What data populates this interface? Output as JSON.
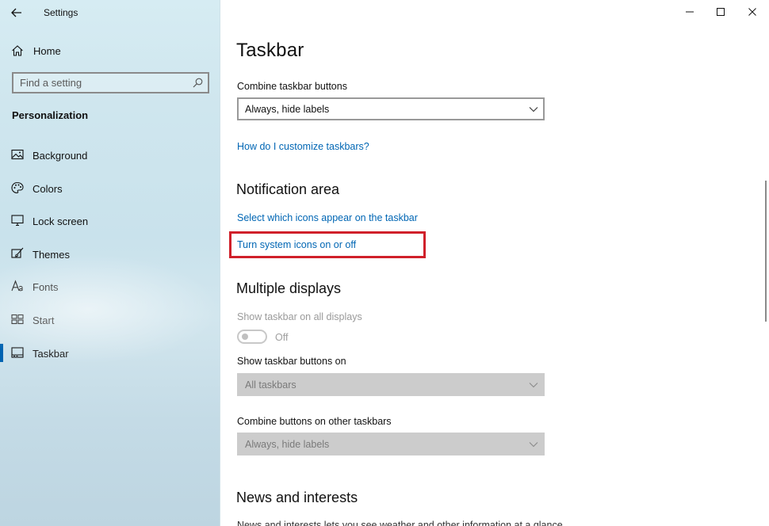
{
  "window": {
    "title": "Settings"
  },
  "sidebar": {
    "home_label": "Home",
    "search_placeholder": "Find a setting",
    "section_label": "Personalization",
    "items": [
      {
        "label": "Background",
        "icon": "image-icon"
      },
      {
        "label": "Colors",
        "icon": "palette-icon"
      },
      {
        "label": "Lock screen",
        "icon": "monitor-icon"
      },
      {
        "label": "Themes",
        "icon": "brush-icon"
      },
      {
        "label": "Fonts",
        "icon": "font-icon"
      },
      {
        "label": "Start",
        "icon": "start-grid-icon"
      },
      {
        "label": "Taskbar",
        "icon": "taskbar-icon",
        "selected": true
      }
    ]
  },
  "main": {
    "title": "Taskbar",
    "combine_label": "Combine taskbar buttons",
    "combine_value": "Always, hide labels",
    "customize_link": "How do I customize taskbars?",
    "notification_heading": "Notification area",
    "select_icons_link": "Select which icons appear on the taskbar",
    "system_icons_link": "Turn system icons on or off",
    "multiple_heading": "Multiple displays",
    "show_all_label": "Show taskbar on all displays",
    "show_all_state": "Off",
    "show_buttons_label": "Show taskbar buttons on",
    "show_buttons_value": "All taskbars",
    "combine_other_label": "Combine buttons on other taskbars",
    "combine_other_value": "Always, hide labels",
    "news_heading": "News and interests",
    "news_description": "News and interests lets you see weather and other information at a glance"
  },
  "colors": {
    "accent": "#0063b1",
    "link": "#0066b4",
    "highlight": "#d0202a"
  }
}
